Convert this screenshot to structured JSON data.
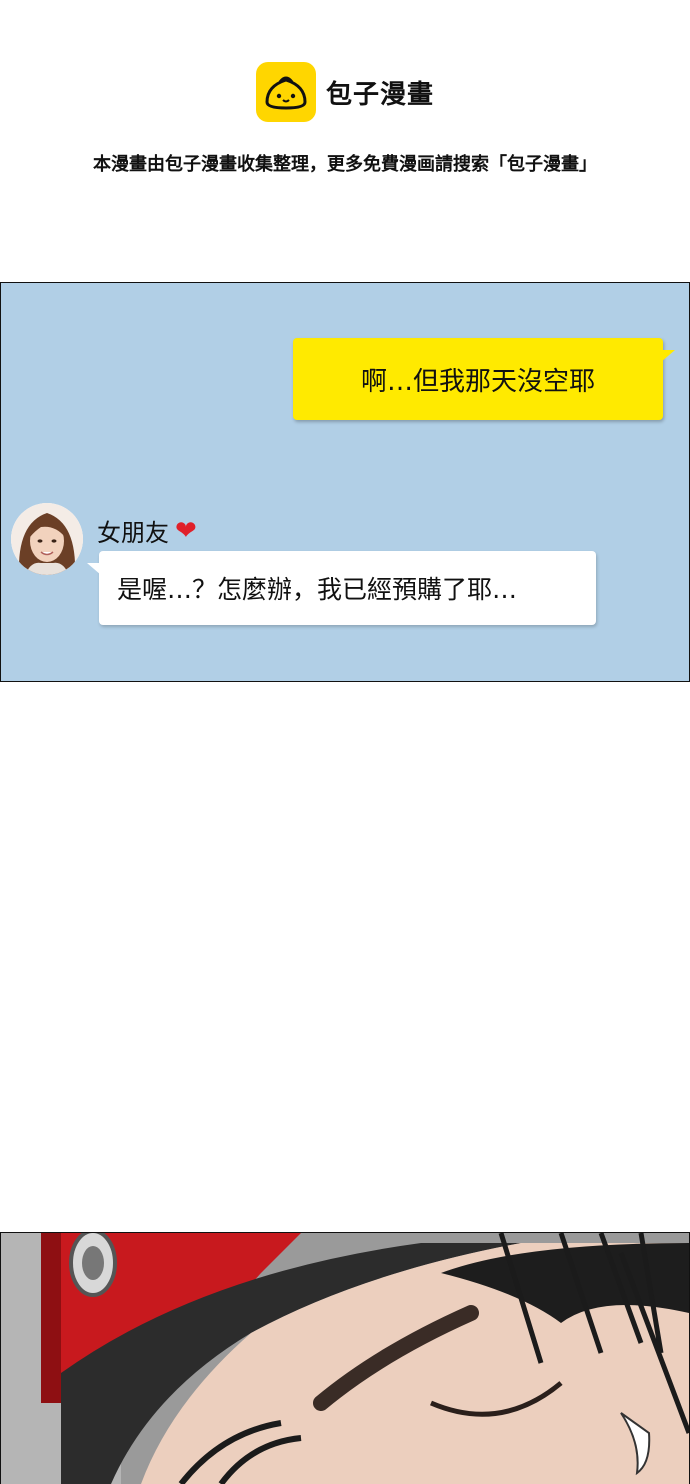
{
  "header": {
    "logo_text": "包子漫畫",
    "notice": "本漫畫由包子漫畫收集整理，更多免費漫画請搜索「包子漫畫」"
  },
  "chat": {
    "outgoing_message": "啊…但我那天沒空耶",
    "sender_name": "女朋友",
    "heart": "❤",
    "incoming_message": "是喔…？怎麼辦，我已經預購了耶…"
  },
  "colors": {
    "chat_background": "#B1CFE6",
    "outgoing_bubble": "#FFEA00",
    "incoming_bubble": "#FFFFFF",
    "logo_yellow": "#FFD600"
  }
}
